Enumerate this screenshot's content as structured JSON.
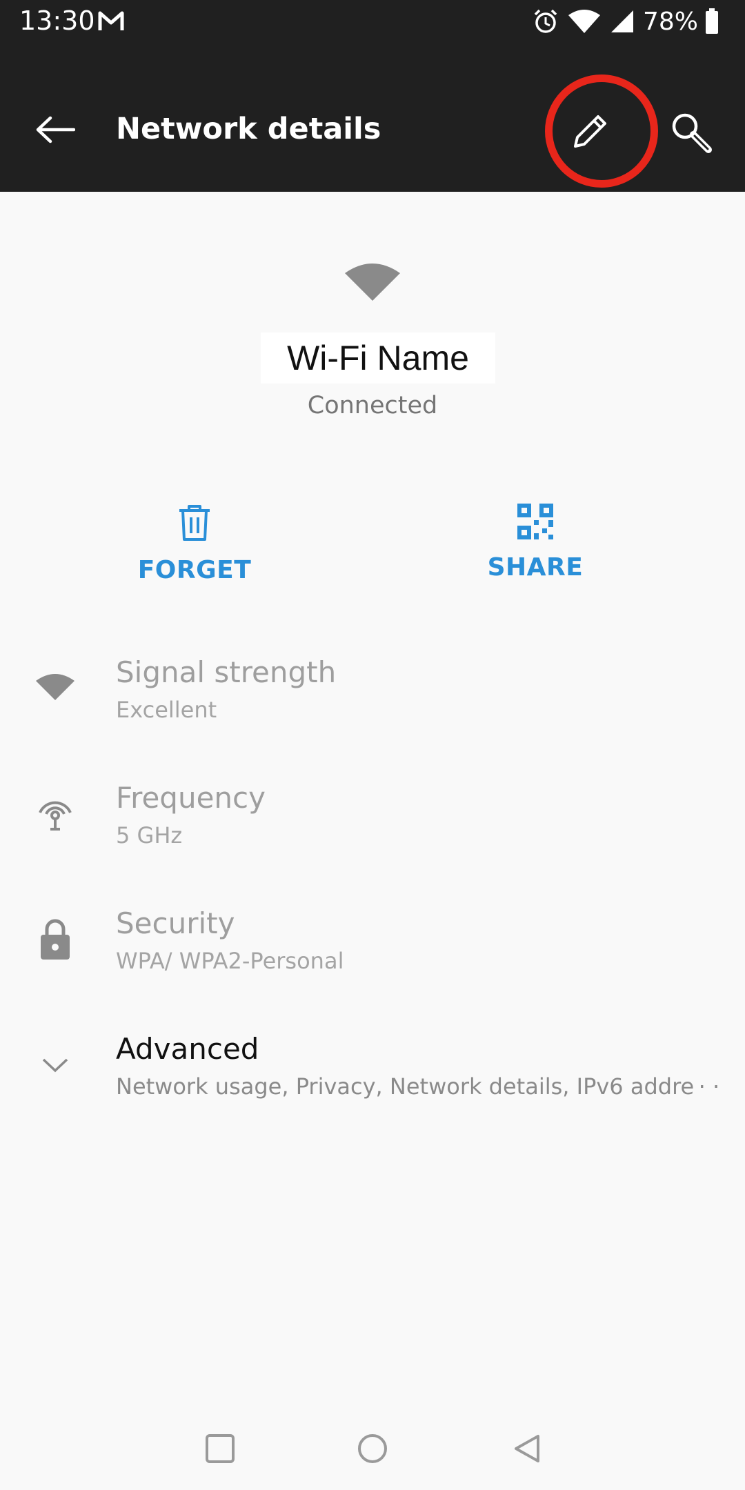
{
  "status_bar": {
    "time": "13:30",
    "notification_icon": "gmail-icon",
    "battery_percent": "78%",
    "icons": [
      "alarm-icon",
      "wifi-icon",
      "cell-signal-icon",
      "battery-icon"
    ]
  },
  "app_bar": {
    "title": "Network details",
    "back_icon": "back-arrow-icon",
    "edit_icon": "pencil-icon",
    "search_icon": "search-icon"
  },
  "network": {
    "name": "Wi-Fi Name",
    "status": "Connected"
  },
  "actions": {
    "forget_label": "FORGET",
    "share_label": "SHARE"
  },
  "details": {
    "signal": {
      "title": "Signal strength",
      "value": "Excellent"
    },
    "frequency": {
      "title": "Frequency",
      "value": "5 GHz"
    },
    "security": {
      "title": "Security",
      "value": "WPA/ WPA2-Personal"
    },
    "advanced": {
      "title": "Advanced",
      "value": "Network usage, Privacy, Network details, IPv6 addre · ·"
    }
  },
  "colors": {
    "appbar_bg": "#202020",
    "accent": "#2a8fd8",
    "highlight": "#e8261b",
    "page_bg": "#f9f9f9"
  }
}
